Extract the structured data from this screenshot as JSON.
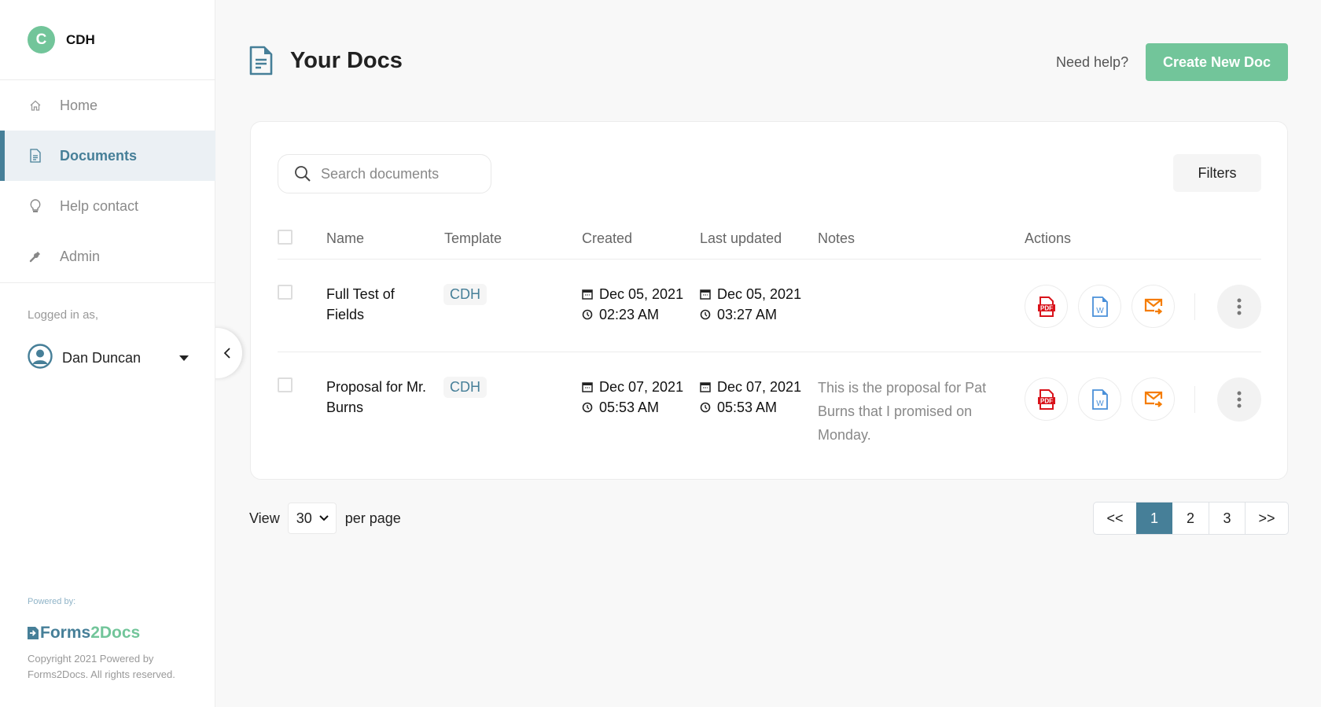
{
  "sidebar": {
    "org_initial": "C",
    "org_name": "CDH",
    "nav": [
      {
        "label": "Home",
        "icon": "home-icon",
        "active": false
      },
      {
        "label": "Documents",
        "icon": "document-icon",
        "active": true
      },
      {
        "label": "Help contact",
        "icon": "lightbulb-icon",
        "active": false
      },
      {
        "label": "Admin",
        "icon": "wrench-icon",
        "active": false
      }
    ],
    "logged_in_label": "Logged in as,",
    "user_name": "Dan Duncan",
    "powered_by": "Powered by:",
    "logo_part1": "Forms",
    "logo_part2": "2Docs",
    "copyright": "Copyright 2021 Powered by Forms2Docs. All rights reserved."
  },
  "header": {
    "title": "Your Docs",
    "help_link": "Need help?",
    "create_button": "Create New Doc"
  },
  "toolbar": {
    "search_placeholder": "Search documents",
    "filters_label": "Filters"
  },
  "table": {
    "columns": [
      "Name",
      "Template",
      "Created",
      "Last updated",
      "Notes",
      "Actions"
    ],
    "rows": [
      {
        "name": "Full Test of Fields",
        "template": "CDH",
        "created_date": "Dec 05, 2021",
        "created_time": "02:23 AM",
        "updated_date": "Dec 05, 2021",
        "updated_time": "03:27 AM",
        "notes": ""
      },
      {
        "name": "Proposal for Mr. Burns",
        "template": "CDH",
        "created_date": "Dec 07, 2021",
        "created_time": "05:53 AM",
        "updated_date": "Dec 07, 2021",
        "updated_time": "05:53 AM",
        "notes": "This is the proposal for Pat Burns that I promised on Monday."
      }
    ],
    "actions": [
      "download-pdf",
      "download-word",
      "email"
    ]
  },
  "footer": {
    "view_label": "View",
    "per_page_value": "30",
    "per_page_label": "per page",
    "pagination": [
      "<<",
      "1",
      "2",
      "3",
      ">>"
    ],
    "current_page": "1"
  },
  "colors": {
    "primary": "#467f98",
    "accent_green": "#72c59a",
    "pdf_red": "#d9131b",
    "word_blue": "#4a90d9",
    "email_orange": "#f57c00"
  }
}
